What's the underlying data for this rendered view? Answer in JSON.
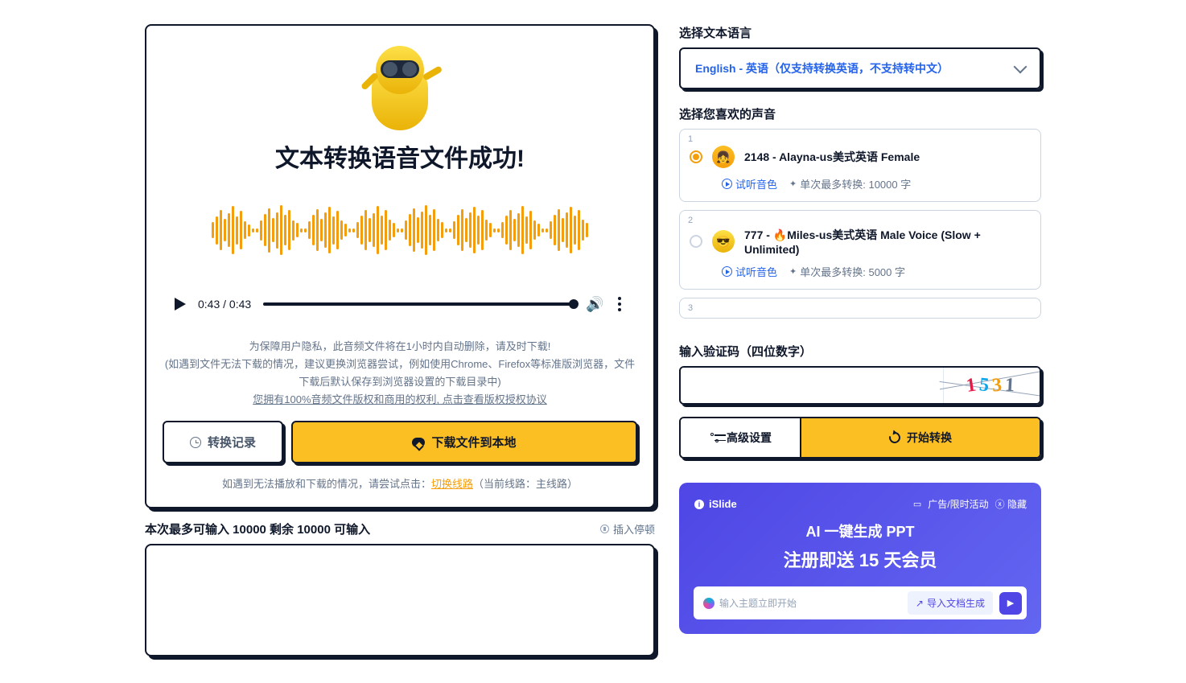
{
  "left": {
    "title": "文本转换语音文件成功!",
    "audio": {
      "current": "0:43",
      "total": "0:43"
    },
    "notice_line1": "为保障用户隐私，此音频文件将在1小时内自动删除，请及时下载!",
    "notice_line2": "(如遇到文件无法下载的情况，建议更换浏览器尝试，例如使用Chrome、Firefox等标准版浏览器，文件下载后默认保存到浏览器设置的下载目录中)",
    "notice_line3": "您拥有100%音频文件版权和商用的权利, 点击查看版权授权协议",
    "history_btn": "转换记录",
    "download_btn": "下载文件到本地",
    "fallback_pre": "如遇到无法播放和下载的情况，请尝试点击：",
    "fallback_link": "切换线路",
    "fallback_post": "（当前线路：主线路）",
    "counter_text": "本次最多可输入 10000 剩余 10000 可输入",
    "insert_pause": "插入停顿"
  },
  "right": {
    "lang_label": "选择文本语言",
    "lang_value": "English - 英语（仅支持转换英语，不支持转中文）",
    "voice_label": "选择您喜欢的声音",
    "voices": [
      {
        "num": "1",
        "name": "2148 - Alayna-us美式英语 Female",
        "preview": "试听音色",
        "limit": "单次最多转换: 10000 字",
        "active": true
      },
      {
        "num": "2",
        "name": "777 - 🔥Miles-us美式英语 Male Voice (Slow + Unlimited)",
        "preview": "试听音色",
        "limit": "单次最多转换: 5000 字",
        "active": false
      },
      {
        "num": "3",
        "name": "",
        "preview": "",
        "limit": "",
        "active": false
      }
    ],
    "captcha_label": "输入验证码（四位数字）",
    "captcha_chars": [
      "1",
      "5",
      "3",
      "1"
    ],
    "settings_btn": "高级设置",
    "start_btn": "开始转换",
    "ad": {
      "logo": "iSlide",
      "badge": "广告/限时活动",
      "hide": "隐藏",
      "title": "AI 一键生成 PPT",
      "subtitle": "注册即送 15 天会员",
      "placeholder": "输入主题立即开始",
      "import": "导入文档生成"
    }
  }
}
